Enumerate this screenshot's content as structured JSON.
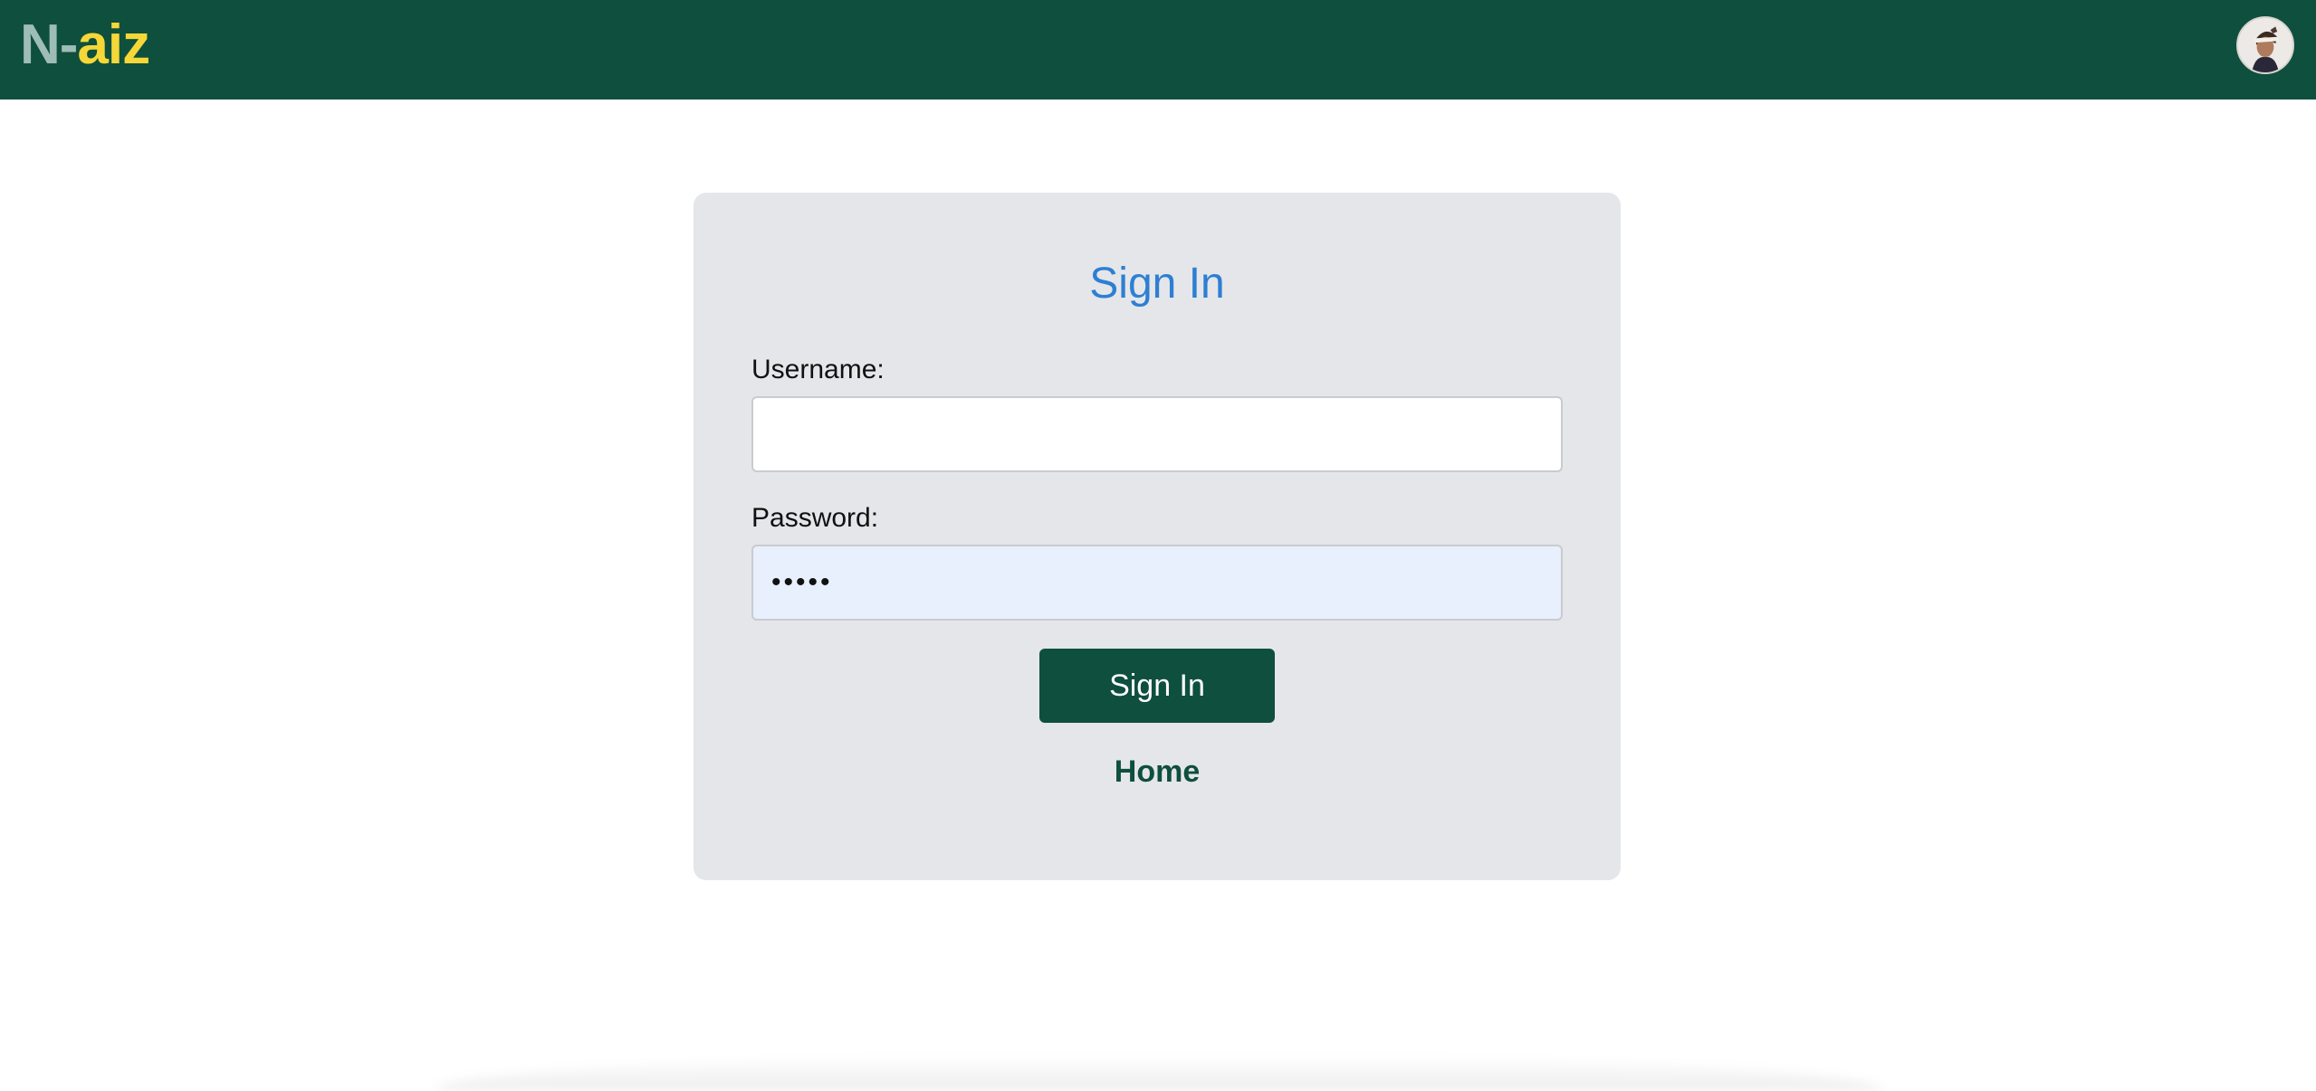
{
  "app": {
    "logo_part1": "N-",
    "logo_part2": "aiz",
    "colors": {
      "header_bg": "#0e4f3d",
      "logo_n": "#9dbdb5",
      "logo_aiz": "#f5d738",
      "title": "#2d7fd3",
      "button_bg": "#0e4f3d",
      "card_bg": "#e5e6e9"
    }
  },
  "header": {
    "avatar_icon": "user-avatar-icon"
  },
  "signin": {
    "title": "Sign In",
    "username_label": "Username:",
    "username_value": "",
    "password_label": "Password:",
    "password_value": "•••••",
    "submit_label": "Sign In",
    "home_link": "Home"
  }
}
